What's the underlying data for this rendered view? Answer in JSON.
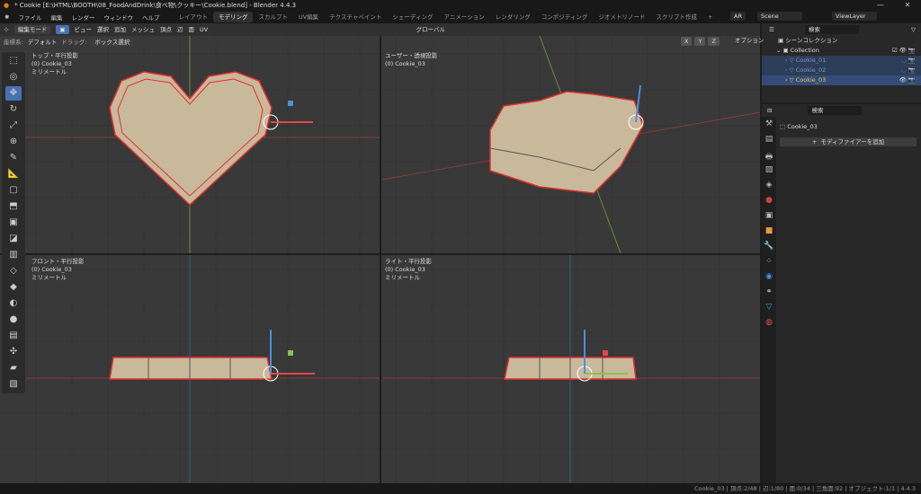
{
  "title": "* Cookie [E:\\HTML\\BOOTH\\08_FoodAndDrink\\食べ物\\クッキー\\Cookie.blend] - Blender 4.4.3",
  "menu": [
    "ファイル",
    "編集",
    "レンダー",
    "ウィンドウ",
    "ヘルプ"
  ],
  "workspaces": [
    "レイアウト",
    "モデリング",
    "スカルプト",
    "UV編集",
    "テクスチャペイント",
    "シェーディング",
    "アニメーション",
    "レンダリング",
    "コンポジティング",
    "ジオメトリノード",
    "スクリプト作成",
    "+"
  ],
  "active_workspace": "モデリング",
  "scene": "Scene",
  "viewlayer": "ViewLayer",
  "render_engine": "AR",
  "header": {
    "mode": "編集モード",
    "menus": [
      "ビュー",
      "選択",
      "追加",
      "メッシュ",
      "頂点",
      "辺",
      "面",
      "UV"
    ],
    "transform": "グローバル",
    "options": "オプション",
    "axes": [
      "X",
      "Y",
      "Z"
    ]
  },
  "toolsettings": {
    "coord_label": "座標系:",
    "coord_value": "デフォルト",
    "drag_label": "ドラッグ:",
    "drag_value": "ボックス選択"
  },
  "viewports": [
    {
      "view": "トップ・平行投影",
      "object": "(0) Cookie_03",
      "unit": "ミリメートル"
    },
    {
      "view": "ユーザー・透視投影",
      "object": "(0) Cookie_03",
      "unit": ""
    },
    {
      "view": "フロント・平行投影",
      "object": "(0) Cookie_03",
      "unit": "ミリメートル"
    },
    {
      "view": "ライト・平行投影",
      "object": "(0) Cookie_03",
      "unit": "ミリメートル"
    }
  ],
  "outliner": {
    "search_placeholder": "検索",
    "scene_collection": "シーンコレクション",
    "collection": "Collection",
    "items": [
      "Cookie_01",
      "Cookie_02",
      "Cookie_03"
    ],
    "active": "Cookie_03"
  },
  "properties": {
    "search_placeholder": "検索",
    "object": "Cookie_03",
    "add_modifier": "モディファイアーを追加"
  },
  "status": "Cookie_03 | 頂点:2/48 | 辺:1/80 | 面:0/34 | 三角面:92 | オブジェクト:1/1 | 4.4.3",
  "colors": {
    "accent": "#4772b3",
    "selection": "#e23030",
    "x_axis": "#e04848",
    "y_axis": "#8bc34a",
    "z_axis": "#4a8fe0",
    "cookie": "#c9b99b"
  }
}
